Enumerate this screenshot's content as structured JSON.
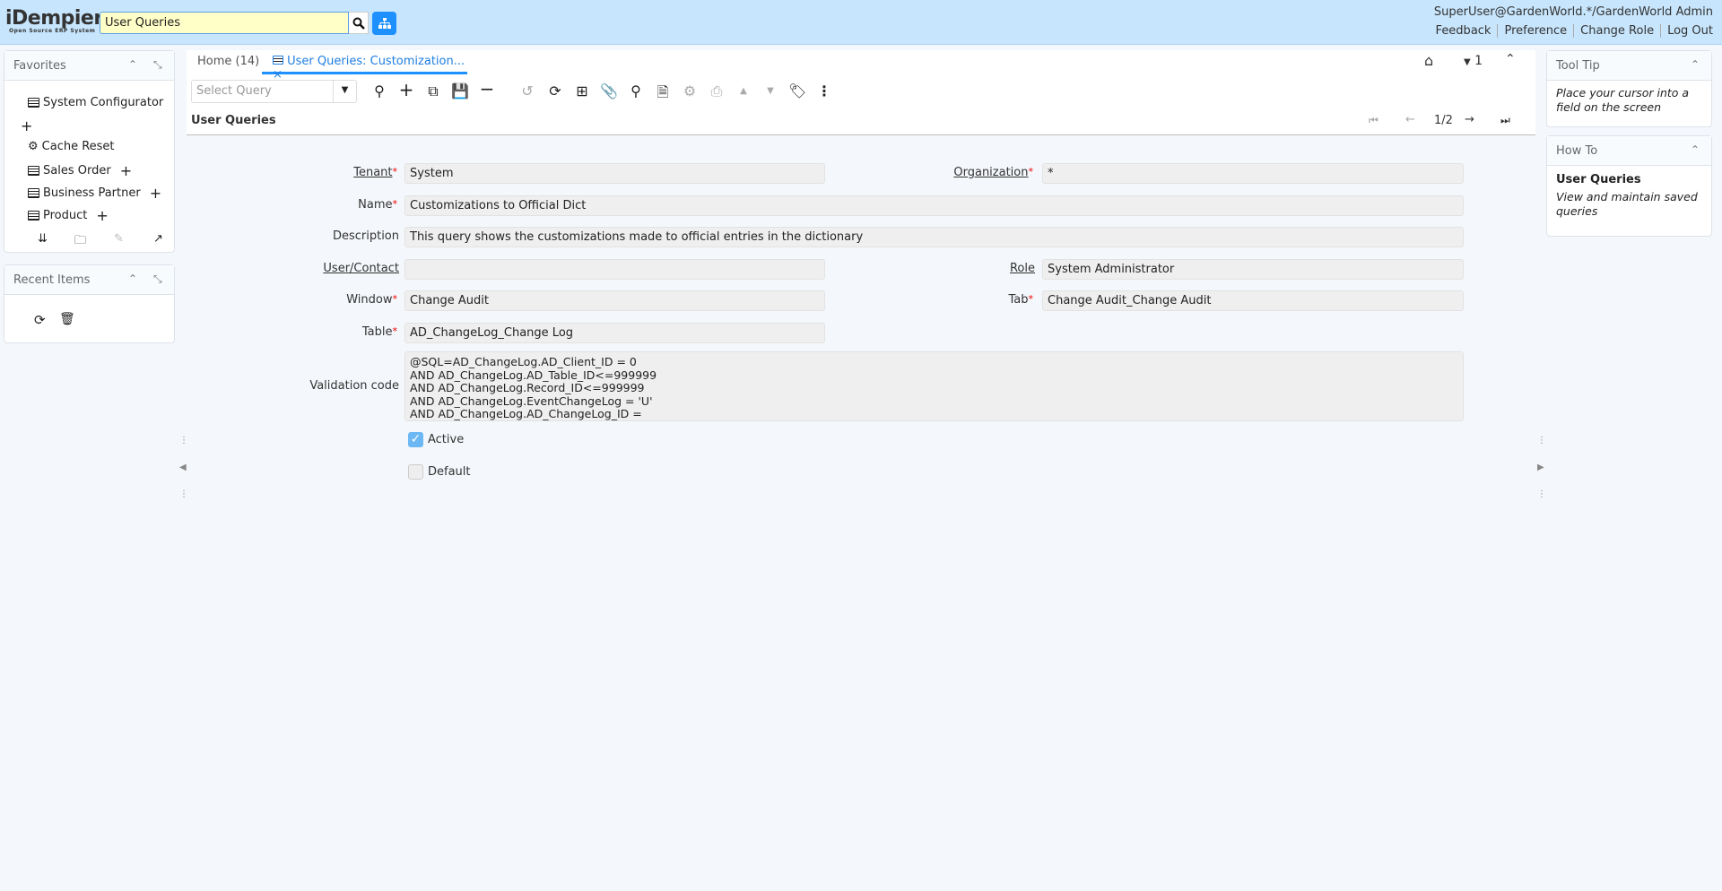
{
  "header": {
    "logo": "iDempiere",
    "logo_sub": "Open Source ERP System",
    "search_value": "User Queries",
    "user": "SuperUser@GardenWorld.*/GardenWorld Admin",
    "links": [
      "Feedback",
      "Preference",
      "Change Role",
      "Log Out"
    ]
  },
  "favorites": {
    "title": "Favorites",
    "items": [
      {
        "label": "System Configurator",
        "icon": "list-icon"
      },
      {
        "label": "Cache Reset",
        "icon": "gear-icon"
      },
      {
        "label": "Sales Order",
        "icon": "list-icon"
      },
      {
        "label": "Business Partner",
        "icon": "list-icon"
      },
      {
        "label": "Product",
        "icon": "list-icon"
      }
    ]
  },
  "recent": {
    "title": "Recent Items"
  },
  "tabs": [
    {
      "label": "Home (14)"
    },
    {
      "label": "User Queries: Customization..."
    }
  ],
  "toolbar": {
    "query_placeholder": "Select Query",
    "nav_count": "1"
  },
  "form": {
    "title": "User Queries",
    "record": "1/2",
    "tenant_label": "Tenant",
    "tenant": "System",
    "org_label": "Organization",
    "org": "*",
    "name_label": "Name",
    "name": "Customizations to Official Dict",
    "desc_label": "Description",
    "desc": "This query shows the customizations made to official entries in the dictionary",
    "user_label": "User/Contact",
    "user": "",
    "role_label": "Role",
    "role": "System Administrator",
    "window_label": "Window",
    "window": "Change Audit",
    "tab_label": "Tab",
    "tab": "Change Audit_Change Audit",
    "table_label": "Table",
    "table": "AD_ChangeLog_Change Log",
    "code_label": "Validation code",
    "code": "@SQL=AD_ChangeLog.AD_Client_ID = 0\nAND AD_ChangeLog.AD_Table_ID<=999999\nAND AD_ChangeLog.Record_ID<=999999\nAND AD_ChangeLog.EventChangeLog = 'U'\nAND AD_ChangeLog.AD_ChangeLog_ID =\n(SELECT MAX(lo.AD_ChangeLog_ID)",
    "active_label": "Active",
    "active": true,
    "default_label": "Default",
    "default": false
  },
  "tooltip": {
    "title": "Tool Tip",
    "text": "Place your cursor into a field on the screen"
  },
  "howto": {
    "title": "How To",
    "heading": "User Queries",
    "text": "View and maintain saved queries"
  },
  "colors": {
    "header": "#c7e5fc",
    "accent": "#1e90ff"
  }
}
